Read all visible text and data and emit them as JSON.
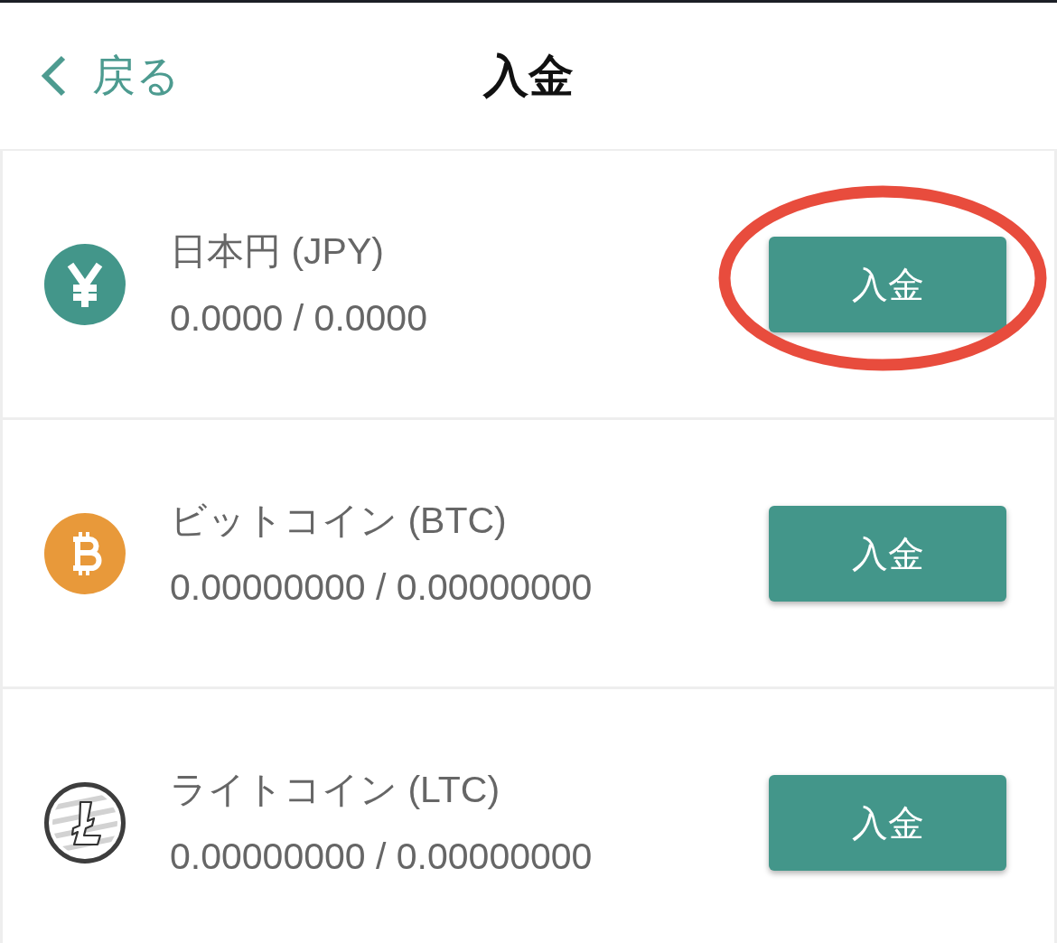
{
  "header": {
    "back_label": "戻る",
    "title": "入金"
  },
  "currencies": [
    {
      "kind": "yen",
      "name": "日本円 (JPY)",
      "balance": "0.0000 / 0.0000",
      "button": "入金",
      "highlighted": true
    },
    {
      "kind": "bitcoin",
      "name": "ビットコイン (BTC)",
      "balance": "0.00000000 / 0.00000000",
      "button": "入金",
      "highlighted": false
    },
    {
      "kind": "litecoin",
      "name": "ライトコイン (LTC)",
      "balance": "0.00000000 / 0.00000000",
      "button": "入金",
      "highlighted": false
    }
  ]
}
